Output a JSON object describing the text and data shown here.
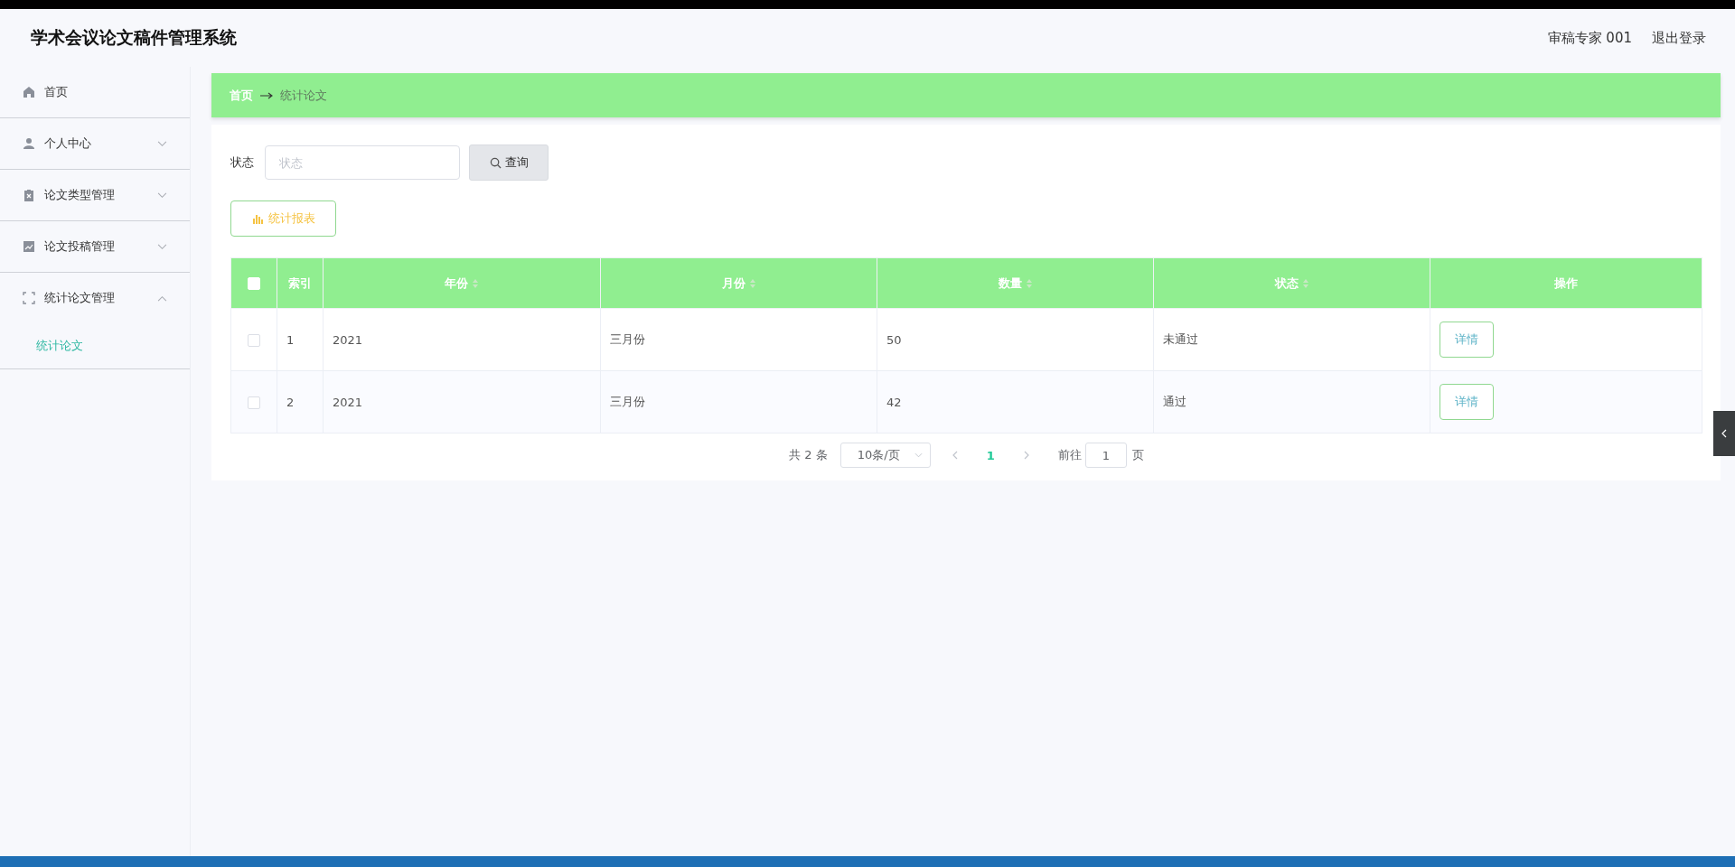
{
  "header": {
    "title": "学术会议论文稿件管理系统",
    "user": "审稿专家 001",
    "logout": "退出登录"
  },
  "sidebar": {
    "items": [
      {
        "label": "首页"
      },
      {
        "label": "个人中心",
        "expanded": false
      },
      {
        "label": "论文类型管理",
        "expanded": false
      },
      {
        "label": "论文投稿管理",
        "expanded": false
      },
      {
        "label": "统计论文管理",
        "expanded": true,
        "children": [
          {
            "label": "统计论文",
            "selected": true
          }
        ]
      }
    ]
  },
  "breadcrumb": [
    "首页",
    "统计论文"
  ],
  "search": {
    "label": "状态",
    "placeholder": "状态",
    "button": "查询"
  },
  "report_button": "统计报表",
  "table": {
    "columns": [
      {
        "label": "索引",
        "sortable": false
      },
      {
        "label": "年份",
        "sortable": true
      },
      {
        "label": "月份",
        "sortable": true
      },
      {
        "label": "数量",
        "sortable": true
      },
      {
        "label": "状态",
        "sortable": true
      },
      {
        "label": "操作",
        "sortable": false
      }
    ],
    "header_checked": false,
    "rows": [
      {
        "checked": false,
        "cells": [
          "1",
          "2021",
          "三月份",
          "50",
          "未通过"
        ],
        "action": "详情"
      },
      {
        "checked": false,
        "cells": [
          "2",
          "2021",
          "三月份",
          "42",
          "通过"
        ],
        "action": "详情"
      }
    ]
  },
  "pagination": {
    "total": "共 2 条",
    "page_size": "10条/页",
    "pages": [
      {
        "label": "1",
        "selected": true
      }
    ],
    "goto_label": "前往",
    "goto_value": "1",
    "goto_suffix": "页"
  }
}
